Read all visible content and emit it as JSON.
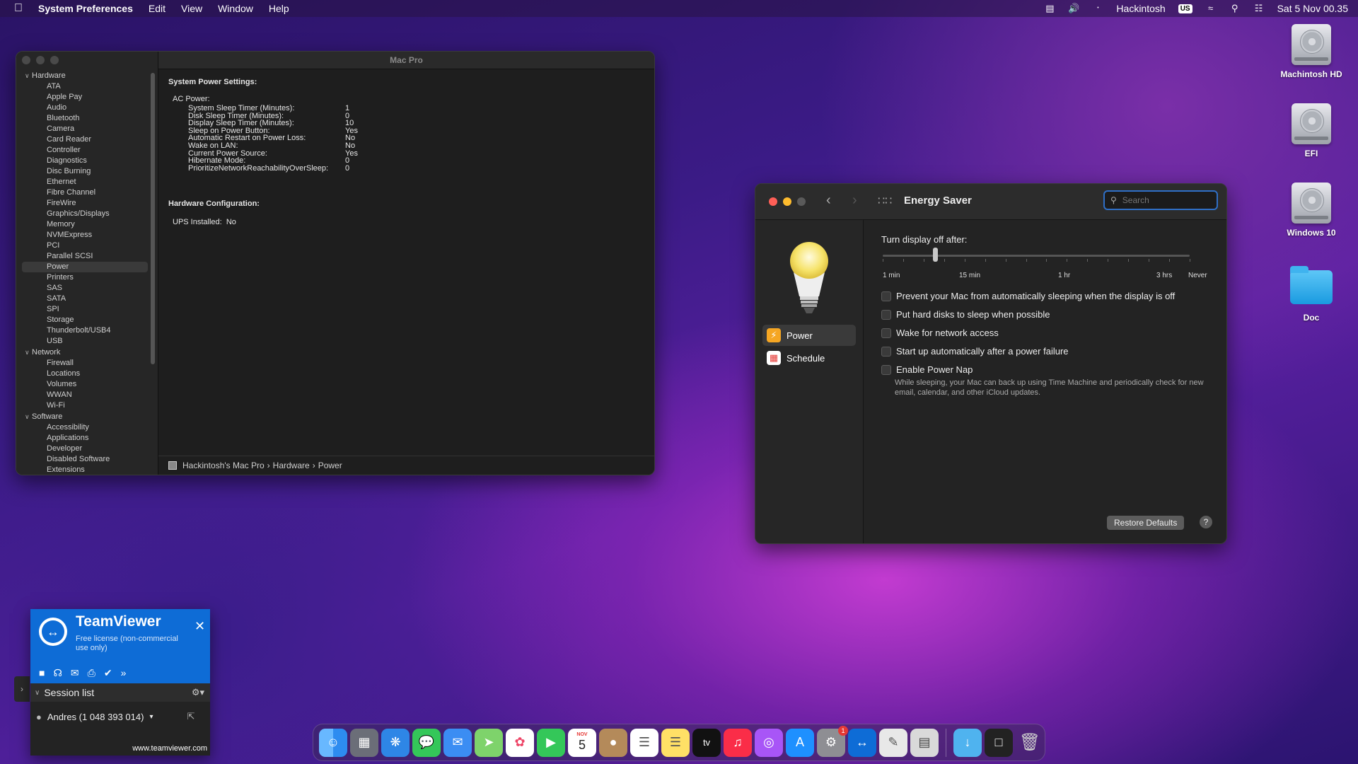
{
  "menubar": {
    "app_name": "System Preferences",
    "menus": [
      "Edit",
      "View",
      "Window",
      "Help"
    ],
    "user": "Hackintosh",
    "input_source": "US",
    "datetime": "Sat 5 Nov  00.35"
  },
  "desktop": {
    "icons": [
      {
        "label": "Machintosh HD"
      },
      {
        "label": "EFI"
      },
      {
        "label": "Windows 10"
      },
      {
        "label": "Doc"
      }
    ]
  },
  "sysinfo": {
    "title": "Mac Pro",
    "groups": [
      {
        "label": "Hardware",
        "items": [
          "ATA",
          "Apple Pay",
          "Audio",
          "Bluetooth",
          "Camera",
          "Card Reader",
          "Controller",
          "Diagnostics",
          "Disc Burning",
          "Ethernet",
          "Fibre Channel",
          "FireWire",
          "Graphics/Displays",
          "Memory",
          "NVMExpress",
          "PCI",
          "Parallel SCSI",
          "Power",
          "Printers",
          "SAS",
          "SATA",
          "SPI",
          "Storage",
          "Thunderbolt/USB4",
          "USB"
        ]
      },
      {
        "label": "Network",
        "items": [
          "Firewall",
          "Locations",
          "Volumes",
          "WWAN",
          "Wi-Fi"
        ]
      },
      {
        "label": "Software",
        "items": [
          "Accessibility",
          "Applications",
          "Developer",
          "Disabled Software",
          "Extensions"
        ]
      }
    ],
    "selected_item": "Power",
    "heading_power": "System Power Settings:",
    "ac_power_label": "AC Power:",
    "ac_power": [
      {
        "k": "System Sleep Timer (Minutes):",
        "v": "1"
      },
      {
        "k": "Disk Sleep Timer (Minutes):",
        "v": "0"
      },
      {
        "k": "Display Sleep Timer (Minutes):",
        "v": "10"
      },
      {
        "k": "Sleep on Power Button:",
        "v": "Yes"
      },
      {
        "k": "Automatic Restart on Power Loss:",
        "v": "No"
      },
      {
        "k": "Wake on LAN:",
        "v": "No"
      },
      {
        "k": "Current Power Source:",
        "v": "Yes"
      },
      {
        "k": "Hibernate Mode:",
        "v": "0"
      },
      {
        "k": "PrioritizeNetworkReachabilityOverSleep:",
        "v": "0"
      }
    ],
    "heading_hw": "Hardware Configuration:",
    "ups_label": "UPS Installed:",
    "ups_value": "No",
    "path": [
      "Hackintosh's Mac Pro",
      "Hardware",
      "Power"
    ]
  },
  "energy": {
    "title": "Energy Saver",
    "search_placeholder": "Search",
    "nav": [
      {
        "label": "Power",
        "icon": "bolt-icon",
        "color": "#f5a623"
      },
      {
        "label": "Schedule",
        "icon": "calendar-icon",
        "color": "#e53935"
      }
    ],
    "slider_label": "Turn display off after:",
    "slider_ticks": [
      "1 min",
      "15 min",
      "1 hr",
      "3 hrs",
      "Never"
    ],
    "slider_value_fraction": 0.17,
    "options": [
      "Prevent your Mac from automatically sleeping when the display is off",
      "Put hard disks to sleep when possible",
      "Wake for network access",
      "Start up automatically after a power failure",
      "Enable Power Nap"
    ],
    "power_nap_note": "While sleeping, your Mac can back up using Time Machine and periodically check for new email, calendar, and other iCloud updates.",
    "restore_label": "Restore Defaults",
    "help_label": "?"
  },
  "teamviewer": {
    "title": "TeamViewer",
    "subtitle": "Free license (non-commercial use only)",
    "session_list": "Session list",
    "user": "Andres (1 048 393 014)",
    "url": "www.teamviewer.com"
  },
  "dock": {
    "calendar_month": "NOV",
    "calendar_day": "5",
    "badge_count": "1",
    "tv_label": "tv"
  }
}
